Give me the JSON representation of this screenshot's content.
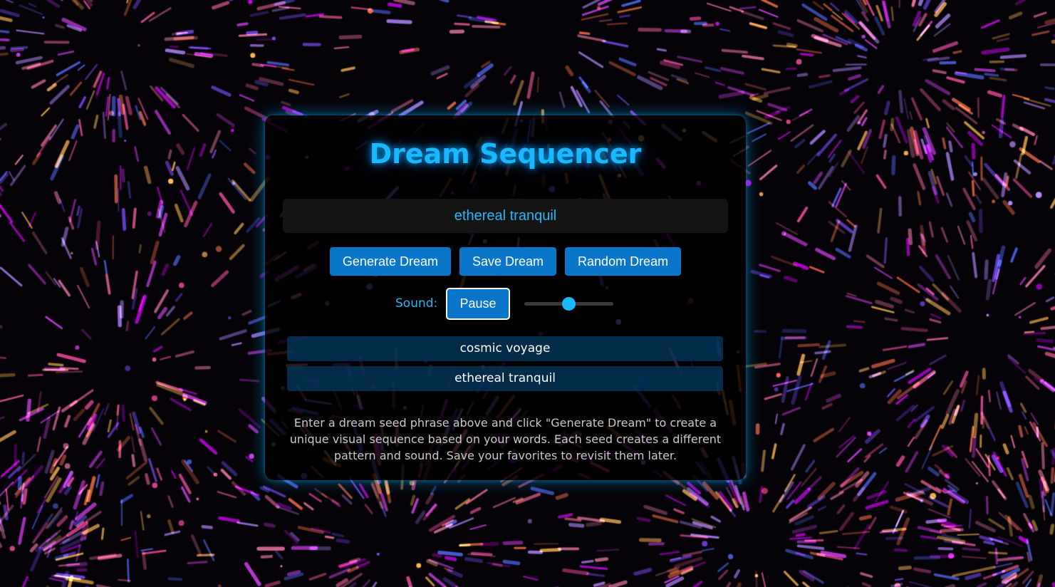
{
  "app": {
    "title": "Dream Sequencer"
  },
  "seed_input": {
    "value": "ethereal tranquil",
    "placeholder": ""
  },
  "actions": {
    "generate_label": "Generate Dream",
    "save_label": "Save Dream",
    "random_label": "Random Dream"
  },
  "sound": {
    "label": "Sound:",
    "toggle_label": "Pause",
    "volume_fraction": 0.5
  },
  "saved_dreams": [
    {
      "label": "cosmic voyage"
    },
    {
      "label": "ethereal tranquil"
    }
  ],
  "info_text": "Enter a dream seed phrase above and click \"Generate Dream\" to create a unique visual sequence based on your words. Each seed creates a different pattern and sound. Save your favorites to revisit them later.",
  "colors": {
    "accent": "#1ab8ff",
    "button": "#0a76c9",
    "background": "#050308",
    "saved_item": "#033c68"
  }
}
